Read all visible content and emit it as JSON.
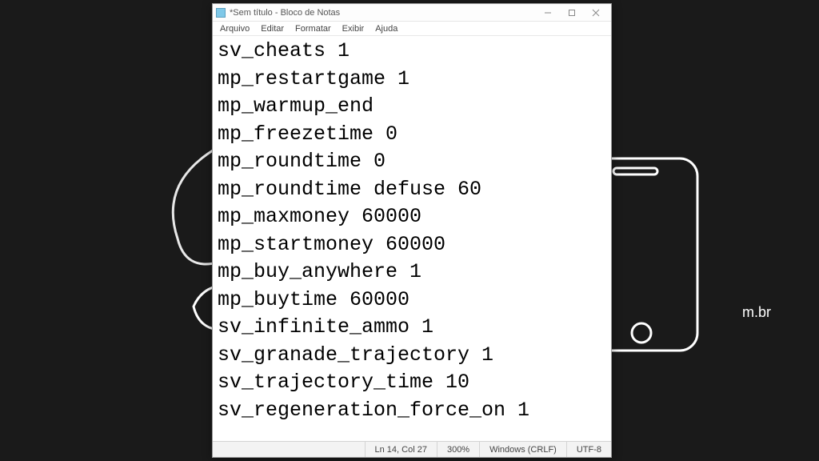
{
  "window": {
    "title": "*Sem título - Bloco de Notas"
  },
  "menu": {
    "file": "Arquivo",
    "edit": "Editar",
    "format": "Formatar",
    "view": "Exibir",
    "help": "Ajuda"
  },
  "content": "sv_cheats 1\nmp_restartgame 1\nmp_warmup_end\nmp_freezetime 0\nmp_roundtime 0\nmp_roundtime defuse 60\nmp_maxmoney 60000\nmp_startmoney 60000\nmp_buy_anywhere 1\nmp_buytime 60000\nsv_infinite_ammo 1\nsv_granade_trajectory 1\nsv_trajectory_time 10\nsv_regeneration_force_on 1",
  "status": {
    "position": "Ln 14, Col 27",
    "zoom": "300%",
    "lineending": "Windows (CRLF)",
    "encoding": "UTF-8"
  },
  "background": {
    "url_fragment": "m.br"
  }
}
